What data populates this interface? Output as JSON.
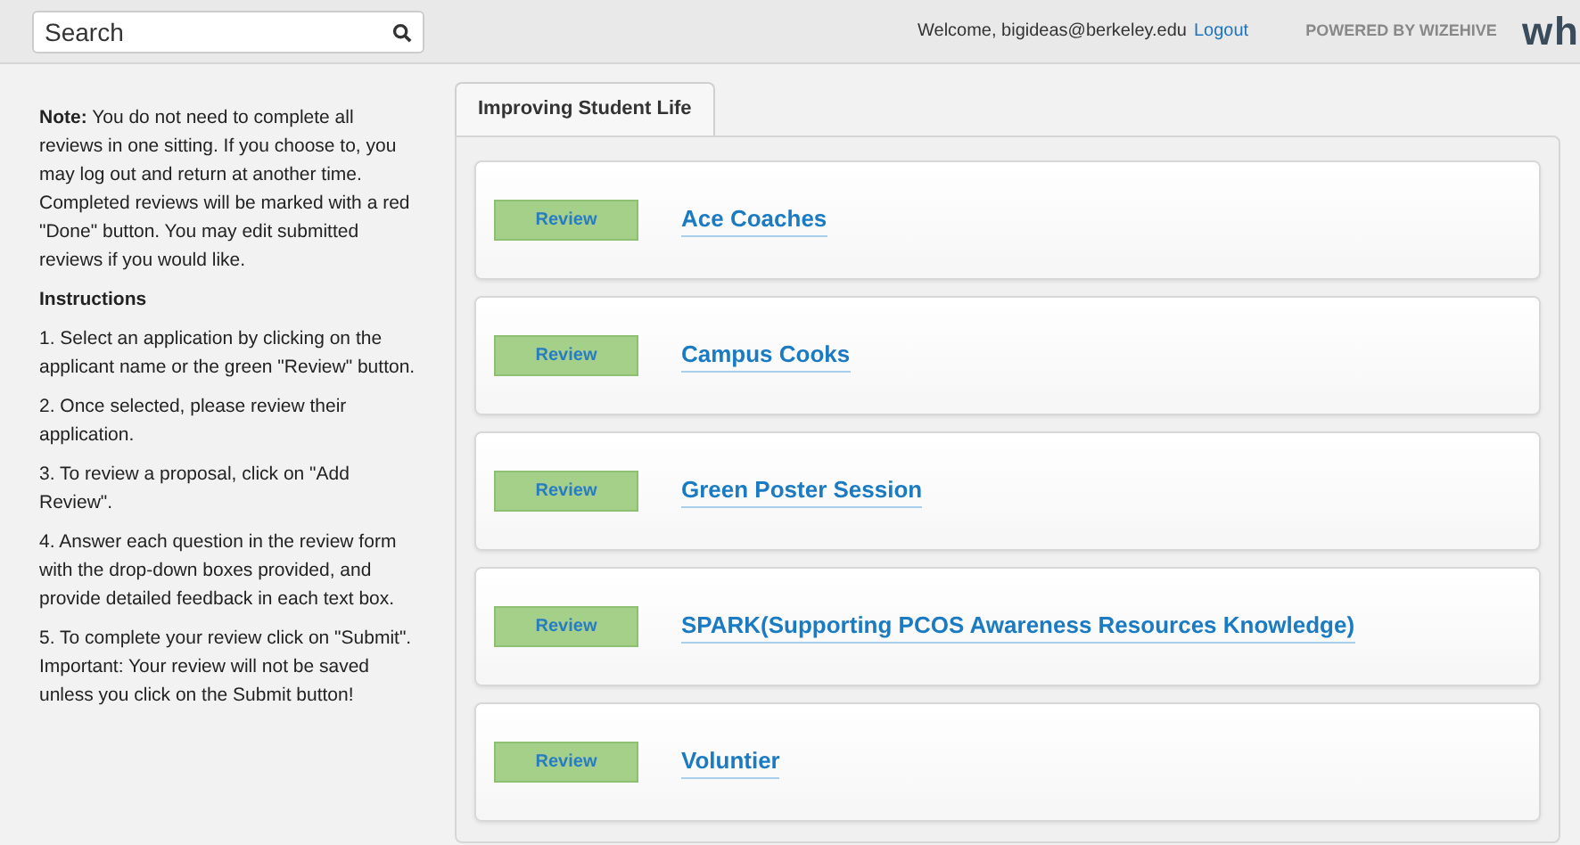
{
  "topbar": {
    "search": {
      "placeholder": "Search"
    },
    "welcome": "Welcome, bigideas@berkeley.edu",
    "logout": "Logout",
    "powered_by": "POWERED BY WIZEHIVE",
    "logo": "wh"
  },
  "sidebar": {
    "note": "**Note:** You do not need to complete all reviews in one sitting. If you choose to, you may log out and return at another time. Completed reviews will be marked with a red \"Done\" button. You may edit submitted reviews if you would like.",
    "instructions_title": "Instructions",
    "steps": [
      "1. Select an application by clicking on the applicant name or the green \"Review\" button.",
      "2. Once selected, please review their application.",
      "3. To review a proposal, click on \"Add Review\".",
      "4. Answer each question in the review form with the drop-down boxes provided, and provide detailed feedback in each text box.",
      "5. To complete your review click on \"Submit\". Important: Your review will not be saved unless you click on the Submit button!"
    ]
  },
  "tabs": [
    {
      "label": "Improving Student Life",
      "selected": true
    }
  ],
  "applications": [
    {
      "button": "Review",
      "name": "Ace Coaches"
    },
    {
      "button": "Review",
      "name": "Campus Cooks"
    },
    {
      "button": "Review",
      "name": "Green Poster Session"
    },
    {
      "button": "Review",
      "name": "SPARK(Supporting PCOS Awareness Resources Knowledge)"
    },
    {
      "button": "Review",
      "name": "Voluntier"
    }
  ]
}
